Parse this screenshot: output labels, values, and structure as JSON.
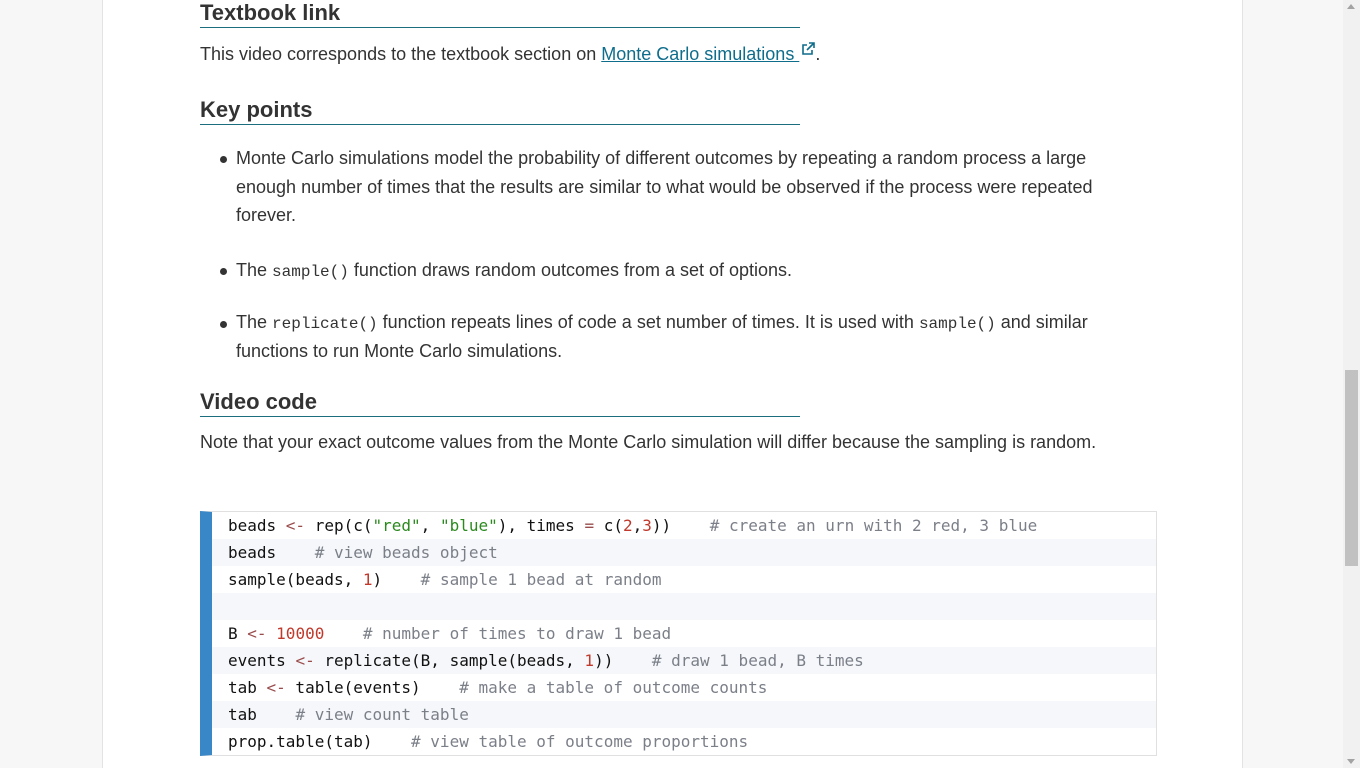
{
  "textbook": {
    "heading": "Textbook link",
    "text_before": "This video corresponds to the textbook section on ",
    "link_text": "Monte Carlo simulations ",
    "text_after": "."
  },
  "keypoints": {
    "heading": "Key points",
    "item1": "Monte Carlo simulations model the probability of different outcomes by repeating a random process a large enough number of times that the results are similar to what would be observed if the process were repeated forever.",
    "item2_a": "The ",
    "item2_code": "sample()",
    "item2_b": " function draws random outcomes from a set of options.",
    "item3_a": "The ",
    "item3_code1": "replicate()",
    "item3_b": " function repeats lines of code a set number of times. It is used with ",
    "item3_code2": "sample()",
    "item3_c": " and similar functions to run Monte Carlo simulations."
  },
  "videocode": {
    "heading": "Video code",
    "note": "Note that your exact outcome values from the Monte Carlo simulation will differ because the sampling is random."
  },
  "code": {
    "l1": {
      "a": "beads ",
      "op": "<-",
      "b": " rep(c(",
      "s1": "\"red\"",
      "c": ", ",
      "s2": "\"blue\"",
      "d": "), times ",
      "op2": "=",
      "e": " c(",
      "n1": "2",
      "f": ",",
      "n2": "3",
      "g": "))    ",
      "cm": "# create an urn with 2 red, 3 blue"
    },
    "l2": {
      "a": "beads    ",
      "cm": "# view beads object"
    },
    "l3": {
      "a": "sample(beads, ",
      "n1": "1",
      "b": ")    ",
      "cm": "# sample 1 bead at random"
    },
    "l5": {
      "a": "B ",
      "op": "<-",
      "b": " ",
      "n1": "10000",
      "c": "    ",
      "cm": "# number of times to draw 1 bead"
    },
    "l6": {
      "a": "events ",
      "op": "<-",
      "b": " replicate(B, sample(beads, ",
      "n1": "1",
      "c": "))    ",
      "cm": "# draw 1 bead, B times"
    },
    "l7": {
      "a": "tab ",
      "op": "<-",
      "b": " table(events)    ",
      "cm": "# make a table of outcome counts"
    },
    "l8": {
      "a": "tab    ",
      "cm": "# view count table"
    },
    "l9": {
      "a": "prop.table(tab)    ",
      "cm": "# view table of outcome proportions"
    }
  },
  "colors": {
    "link": "#0f6d8c",
    "code_border": "#3a87c8",
    "heading_rule": "#1a6e7e"
  },
  "icons": {
    "external_link": "external-link-icon"
  }
}
